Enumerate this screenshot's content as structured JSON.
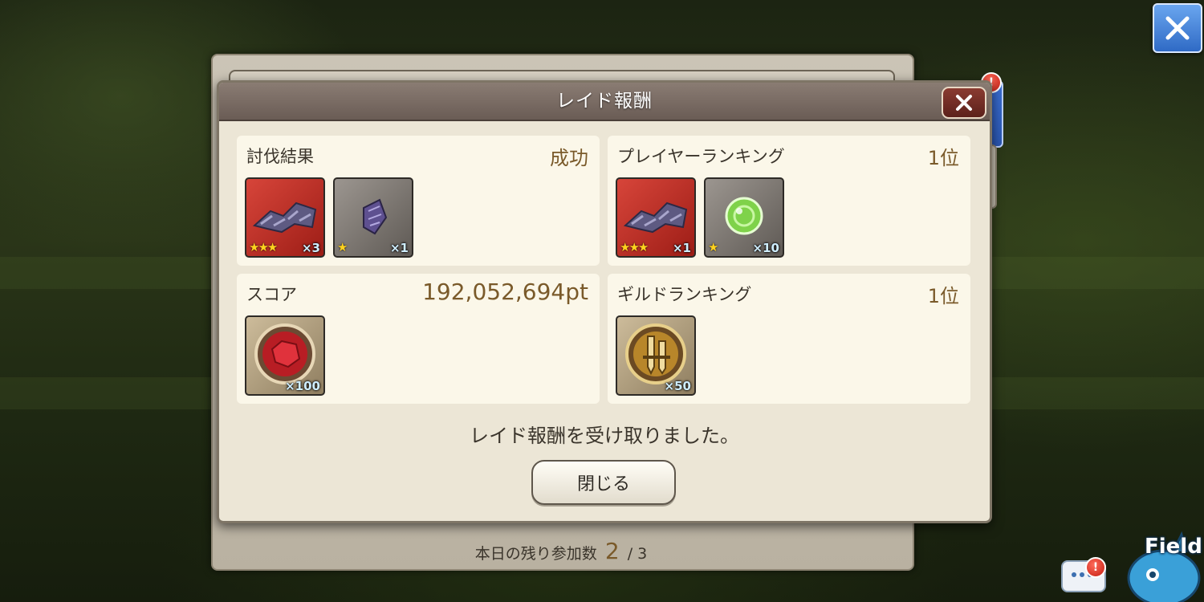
{
  "dialog": {
    "title": "レイド報酬",
    "message": "レイド報酬を受け取りました。",
    "close_button": "閉じる"
  },
  "sections": {
    "subjugation": {
      "label": "討伐結果",
      "value": "成功",
      "items": [
        {
          "icon": "metal-fragments-icon",
          "stars": "★★★",
          "qty": "×3"
        },
        {
          "icon": "metal-shard-icon",
          "stars": "★",
          "qty": "×1"
        }
      ]
    },
    "player_ranking": {
      "label": "プレイヤーランキング",
      "value": "1位",
      "items": [
        {
          "icon": "metal-fragments-icon",
          "stars": "★★★",
          "qty": "×1"
        },
        {
          "icon": "green-orb-icon",
          "stars": "★",
          "qty": "×10"
        }
      ]
    },
    "score": {
      "label": "スコア",
      "value": "192,052,694pt",
      "items": [
        {
          "icon": "red-gem-medal-icon",
          "qty": "×100"
        }
      ]
    },
    "guild_ranking": {
      "label": "ギルドランキング",
      "value": "1位",
      "items": [
        {
          "icon": "guild-sword-medal-icon",
          "qty": "×50"
        }
      ]
    }
  },
  "background_panel": {
    "remaining_label": "本日の残り参加数",
    "remaining_count": "2",
    "remaining_total": "/ 3"
  },
  "corner": {
    "field_label": "Field",
    "badge": "!"
  },
  "colors": {
    "accent_value": "#7a5a2a",
    "title_bar": "#6a5c55",
    "screen_close": "#2f6ac5"
  }
}
